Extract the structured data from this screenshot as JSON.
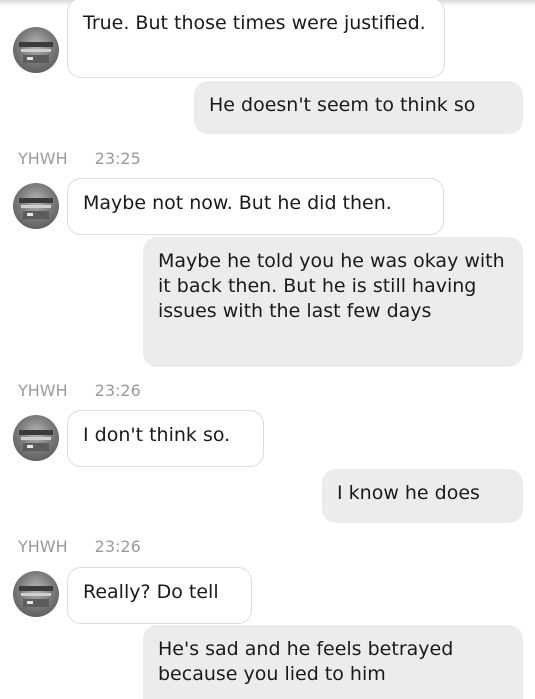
{
  "messages": [
    {
      "direction": "incoming",
      "text": "True. But those times were justified."
    },
    {
      "direction": "outgoing",
      "text": "He doesn't seem to think so"
    },
    {
      "direction": "incoming",
      "sender": "YHWH",
      "time": "23:25",
      "text": "Maybe not now. But he did then."
    },
    {
      "direction": "outgoing",
      "text": "Maybe he told you he was okay with it back then. But he is still having issues with the last few days"
    },
    {
      "direction": "incoming",
      "sender": "YHWH",
      "time": "23:26",
      "text": "I don't think so."
    },
    {
      "direction": "outgoing",
      "text": "I know he does"
    },
    {
      "direction": "incoming",
      "sender": "YHWH",
      "time": "23:26",
      "text": "Really? Do tell"
    },
    {
      "direction": "outgoing",
      "text": "He's sad and he feels betrayed because you lied to him"
    }
  ]
}
